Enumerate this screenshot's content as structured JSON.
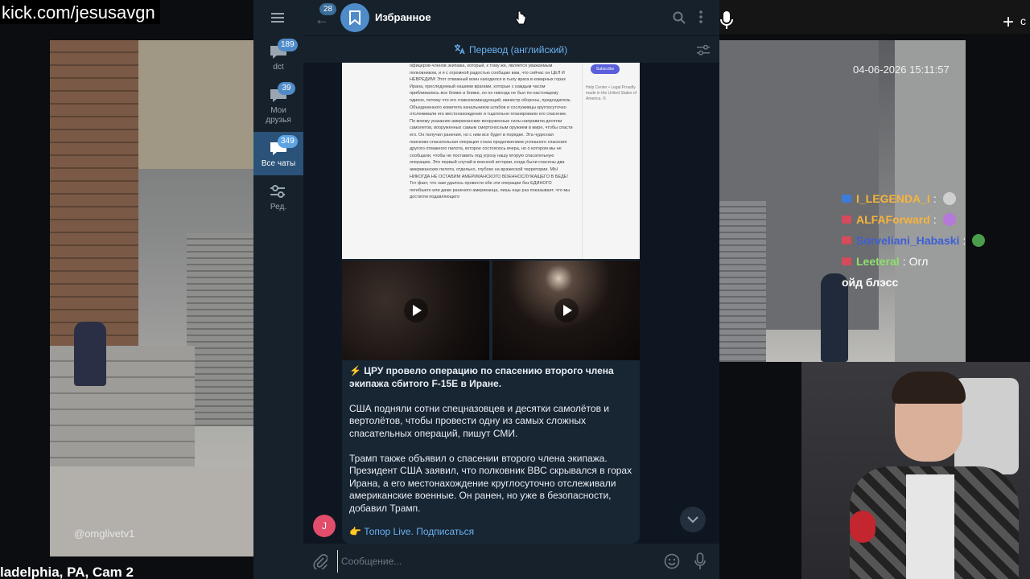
{
  "stream": {
    "url": "kick.com/jesusavgn",
    "topbar_plus": "+",
    "topbar_plus_text": "c",
    "cam_watermark": "@omglivetv1",
    "cam_caption": "ladelphia, PA, Cam 2",
    "cam_timestamp": "04-06-2026 15:11:57",
    "chat": [
      {
        "user": "I_LEGENDA_I",
        "color": "#f7b43a",
        "msg": "",
        "badge": "blue"
      },
      {
        "user": "ALFAForward",
        "color": "#f7b43a",
        "msg": "",
        "badge": "red"
      },
      {
        "user": "Sorveliani_Habaski",
        "color": "#3d5fd6",
        "msg": "",
        "badge": "red"
      },
      {
        "user": "Leeteral",
        "color": "#8ee06a",
        "msg": "Огл",
        "badge": "red"
      },
      {
        "user": "",
        "color": "#fff",
        "msg": "ойд блэсс",
        "badge": ""
      }
    ]
  },
  "telegram": {
    "sidebar": {
      "folders": [
        {
          "label": "dct",
          "badge": "189"
        },
        {
          "label": "Мои друзья",
          "badge": "39"
        },
        {
          "label": "Все чаты",
          "badge": "349"
        },
        {
          "label": "Ред.",
          "badge": ""
        }
      ]
    },
    "header": {
      "back_badge": "28",
      "title": "Избранное"
    },
    "translate_bar": {
      "label": "Перевод (английский)"
    },
    "message": {
      "doc_text": "офицеров-членов экипажа, который, к тому же, является уважаемым полковником, и я с огромной радостью сообщаю вам, что сейчас он ЦЕЛ И НЕВРЕДИМ! Этот отважный воин находился в тылу врага в коварных горах Ирана, преследуемый нашими врагами, которые с каждым часом приближались все ближе и ближе, но он никогда не был по-настоящему одинок, потому что его главнокомандующий, министр обороны, председатель Объединенного комитета начальников штабов и сослуживцы круглосуточно отслеживали его местонахождение и тщательно планировали его спасение. По моему указанию американские вооруженные силы направили десятки самолетов, вооруженных самым смертоносным оружием в мире, чтобы спасти его. Он получил ранения, но с ним все будет в порядке. Эта чудесная поисково-спасательная операция стала продолжением успешного спасения другого отважного пилота, которое состоялось вчера, но о котором мы не сообщали, чтобы не поставить под угрозу нашу вторую спасательную операцию. Это первый случай в военной истории, когда были спасены два американских пилота, отдельно, глубоко на вражеской территории. МЫ НИКОГДА НЕ ОСТАВИМ АМЕРИКАНСКОГО ВОЕННОСЛУЖАЩЕГО В БЕДЕ! Тот факт, что нам удалось провести обе эти операции без ЕДИНОГО погибшего или даже раненого американца, лишь еще раз показывает, что мы достигли подавляющего",
      "doc_subscribe": "Subscribe",
      "doc_aside": "Help Center • Legal Proudly made in the United States of America. ©",
      "headline": "⚡ ЦРУ провело операцию по спасению второго члена экипажа сбитого F-15E в Иране.",
      "para1": "США подняли сотни спецназовцев и десятки самолётов и вертолётов, чтобы провести одну из самых сложных спасательных операций, пишут СМИ.",
      "para2": "Трамп также объявил о спасении второго члена экипажа. Президент США заявил, что полковник ВВС скрывался в горах Ирана, а его местонахождение круглосуточно отслеживали американские военные. Он ранен, но уже в безопасности, добавил Трамп.",
      "footer_emoji": "👉",
      "footer_link": "Топор Live. Подписаться",
      "sender_initial": "J"
    },
    "input": {
      "placeholder": "Сообщение..."
    },
    "colors": {
      "accent": "#6ab2f2",
      "panel": "#17212b",
      "bg": "#0e1621",
      "bubble": "#182533"
    }
  }
}
